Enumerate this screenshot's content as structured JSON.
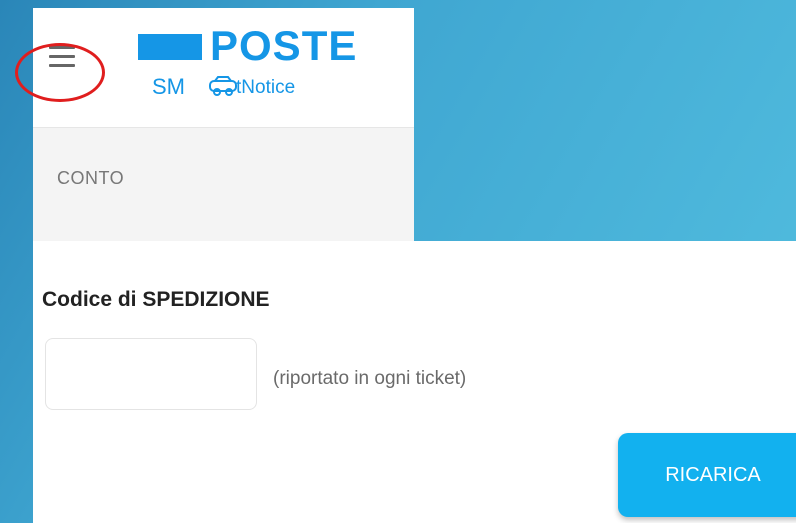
{
  "header": {
    "logo_top": "POSTE",
    "logo_sm": "SM",
    "logo_notice": "tNotice",
    "menu_icon": "hamburger-icon",
    "logo_icon": "car-icon"
  },
  "sidebar": {
    "items": [
      {
        "label": "CONTO"
      }
    ]
  },
  "form": {
    "title": "Codice di SPEDIZIONE",
    "input_value": "",
    "input_placeholder": "",
    "hint": "(riportato in ogni ticket)",
    "button_label": "RICARICA"
  },
  "colors": {
    "brand": "#1596e6",
    "button": "#12b1ef",
    "highlight": "#e01e1e"
  }
}
